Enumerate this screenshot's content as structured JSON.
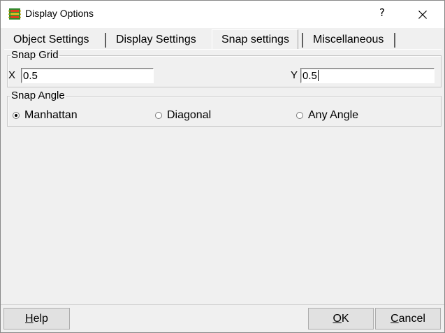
{
  "window": {
    "title": "Display Options",
    "help_symbol": "?",
    "app_icon": "pcb-chip-icon",
    "close_icon": "close-icon"
  },
  "tabs": [
    {
      "label": "Object Settings",
      "active": false
    },
    {
      "label": "Display Settings",
      "active": false
    },
    {
      "label": "Snap settings",
      "active": true
    },
    {
      "label": "Miscellaneous",
      "active": false
    }
  ],
  "snap_grid": {
    "legend": "Snap Grid",
    "x_label": "X",
    "x_value": "0.5",
    "y_label": "Y",
    "y_value": "0.5"
  },
  "snap_angle": {
    "legend": "Snap Angle",
    "options": [
      {
        "label": "Manhattan",
        "checked": true
      },
      {
        "label": "Diagonal",
        "checked": false
      },
      {
        "label": "Any Angle",
        "checked": false
      }
    ]
  },
  "buttons": {
    "help": {
      "mnemonic": "H",
      "rest": "elp"
    },
    "ok": {
      "mnemonic": "O",
      "rest": "K"
    },
    "cancel": {
      "mnemonic": "C",
      "rest": "ancel"
    }
  }
}
